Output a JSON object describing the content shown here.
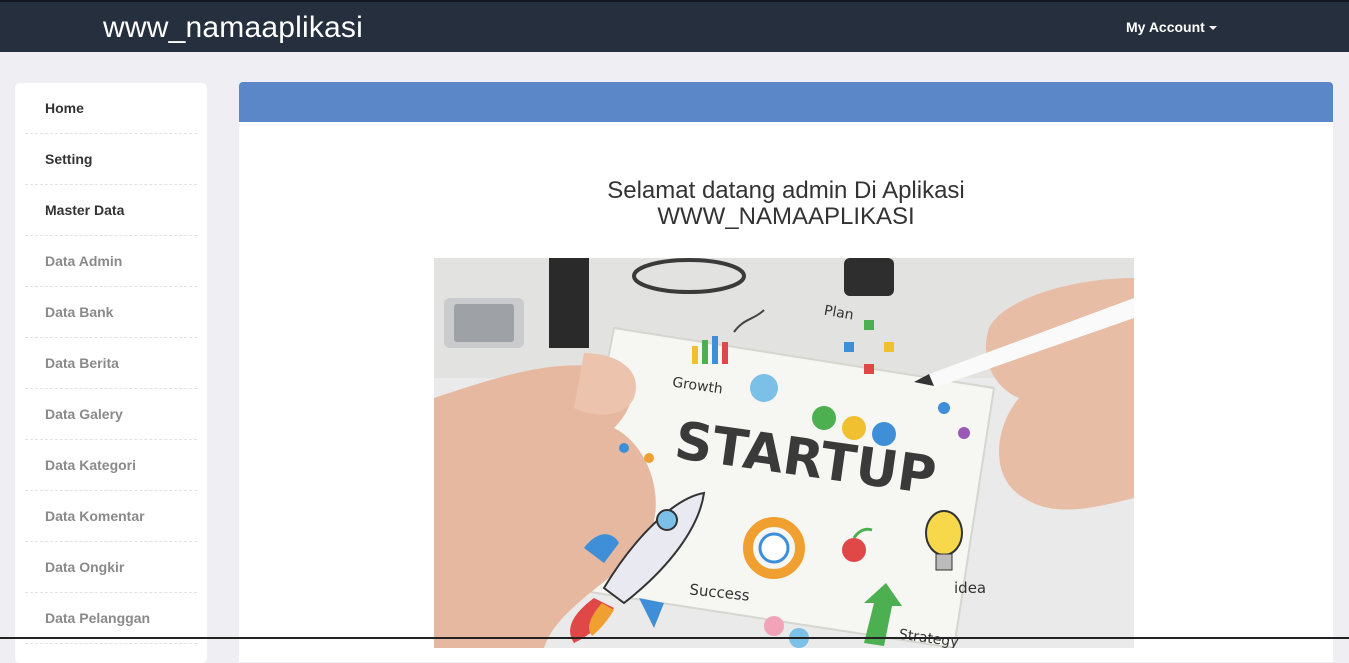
{
  "header": {
    "brand": "www_namaaplikasi",
    "account_label": "My Account"
  },
  "sidebar": {
    "items": [
      {
        "label": "Home",
        "kind": "main"
      },
      {
        "label": "Setting",
        "kind": "main"
      },
      {
        "label": "Master Data",
        "kind": "main"
      },
      {
        "label": "Data Admin",
        "kind": "sub"
      },
      {
        "label": "Data Bank",
        "kind": "sub"
      },
      {
        "label": "Data Berita",
        "kind": "sub"
      },
      {
        "label": "Data Galery",
        "kind": "sub"
      },
      {
        "label": "Data Kategori",
        "kind": "sub"
      },
      {
        "label": "Data Komentar",
        "kind": "sub"
      },
      {
        "label": "Data Ongkir",
        "kind": "sub"
      },
      {
        "label": "Data Pelanggan",
        "kind": "sub"
      }
    ]
  },
  "main": {
    "welcome_line1": "Selamat datang admin Di Aplikasi",
    "welcome_line2": "WWW_NAMAAPLIKASI",
    "image": {
      "headline": "STARTUP",
      "labels": {
        "plan": "Plan",
        "growth": "Growth",
        "success": "Success",
        "idea": "idea",
        "strategy": "Strategy"
      }
    }
  },
  "colors": {
    "topbar": "#252f3d",
    "panel_header": "#5b87c9",
    "background": "#efeff3"
  }
}
